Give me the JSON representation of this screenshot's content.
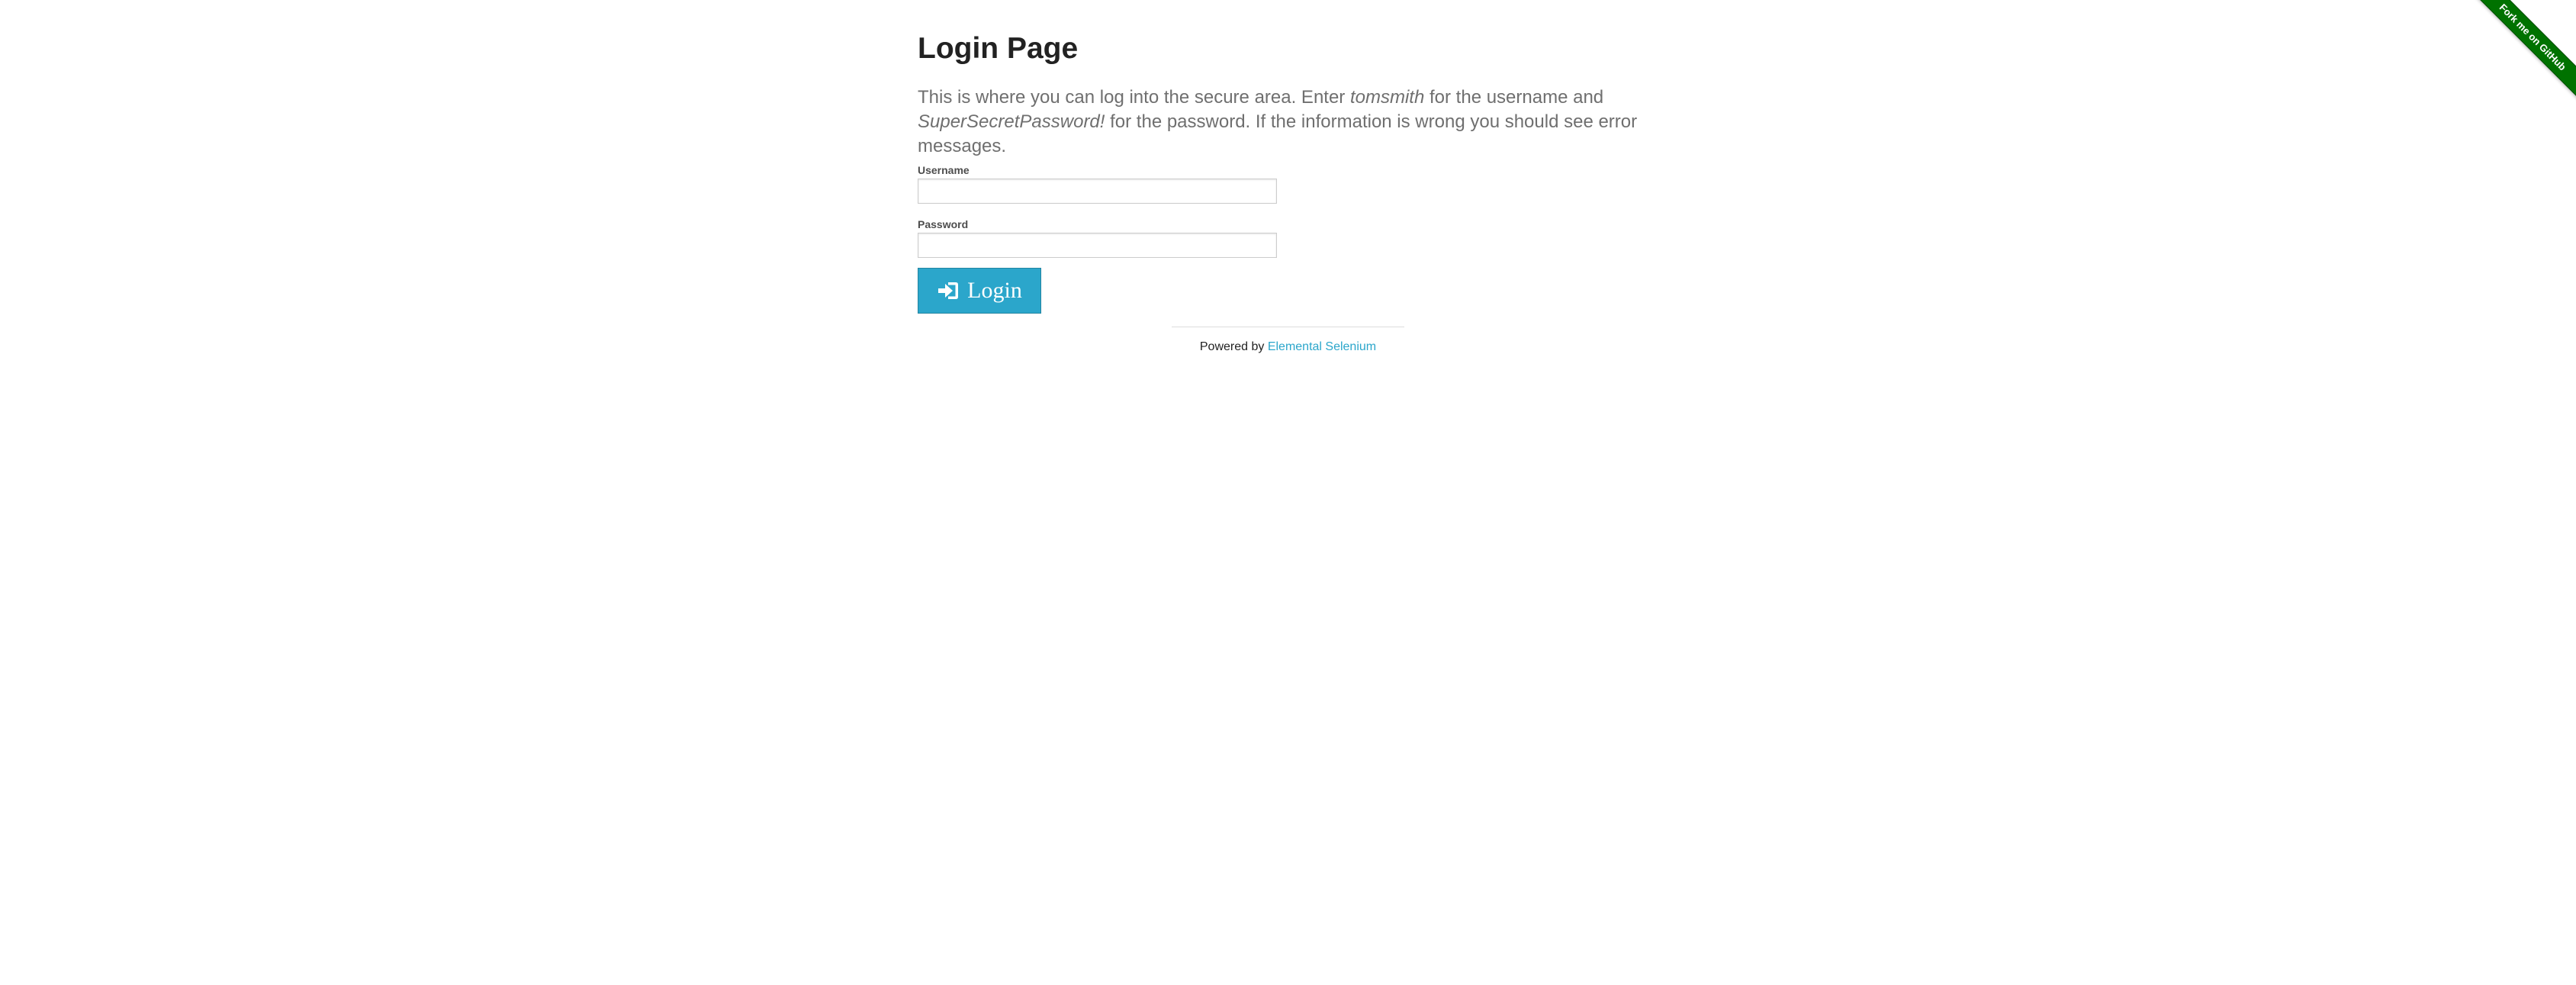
{
  "ribbon": {
    "label": "Fork me on GitHub",
    "color": "#007200"
  },
  "login_page": {
    "title": "Login Page",
    "intro": {
      "part1": "This is where you can log into the secure area. Enter ",
      "username_hint": "tomsmith",
      "part2": " for the username and ",
      "password_hint": "SuperSecretPassword!",
      "part3": " for the password. If the information is wrong you should see error messages."
    },
    "username": {
      "label": "Username",
      "value": ""
    },
    "password": {
      "label": "Password",
      "value": ""
    },
    "login_button": {
      "label": "Login",
      "icon": "sign-in-icon",
      "color": "#2ba6cb"
    }
  },
  "footer": {
    "prefix": "Powered by ",
    "link_text": "Elemental Selenium",
    "link_color": "#2ba6cb"
  }
}
